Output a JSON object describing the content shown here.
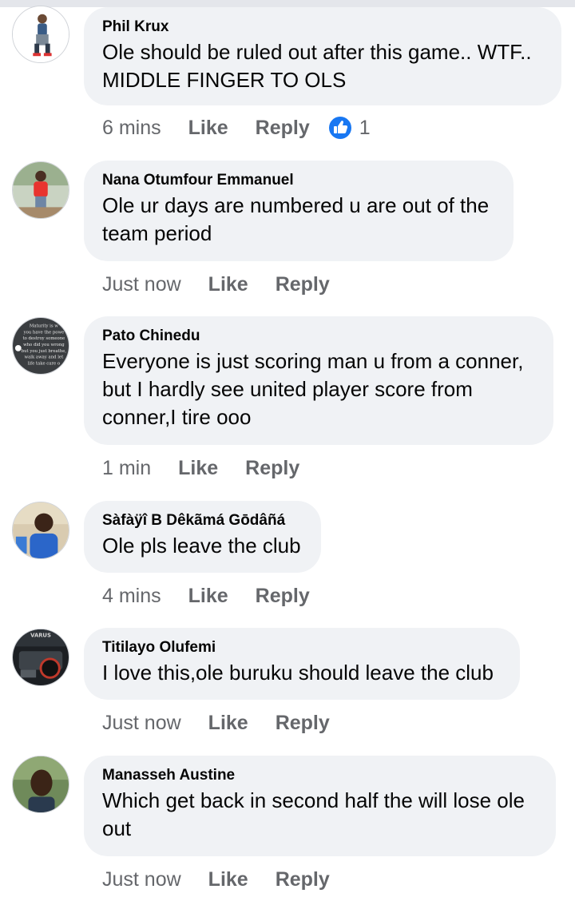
{
  "comments": [
    {
      "author": "Phil Krux",
      "text": "Ole should be ruled out after this game.. WTF.. MIDDLE FINGER TO OLS",
      "time": "6 mins",
      "like": "Like",
      "reply": "Reply",
      "reactions": "1"
    },
    {
      "author": "Nana Otumfour Emmanuel",
      "text": "Ole ur days are numbered u are out of the team period",
      "time": "Just now",
      "like": "Like",
      "reply": "Reply"
    },
    {
      "author": "Pato Chinedu",
      "text": "Everyone is just scoring man u from a conner, but I hardly see united player score from conner,I tire ooo",
      "time": "1 min",
      "like": "Like",
      "reply": "Reply",
      "avatar_text": [
        "Maturity is w",
        "you have the powe",
        "to destroy someone",
        "who did you wrong",
        "but you just breathe,",
        "walk away and let",
        "life take care o"
      ]
    },
    {
      "author": "Sàfàÿî B Dêkãmá Gōdâñá",
      "text": "Ole pls leave the club",
      "time": "4 mins",
      "like": "Like",
      "reply": "Reply"
    },
    {
      "author": "Titilayo Olufemi",
      "text": "I love this,ole buruku should leave the club",
      "time": "Just now",
      "like": "Like",
      "reply": "Reply",
      "avatar_text": [
        "VARUS"
      ]
    },
    {
      "author": "Manasseh Austine",
      "text": "Which get back in second half the will lose ole out",
      "time": "Just now",
      "like": "Like",
      "reply": "Reply"
    }
  ],
  "colors": {
    "bubble": "#f0f2f5",
    "meta": "#65676b",
    "like_reaction": "#1877f2"
  },
  "icons": {
    "reaction": "thumbs-up-icon"
  }
}
